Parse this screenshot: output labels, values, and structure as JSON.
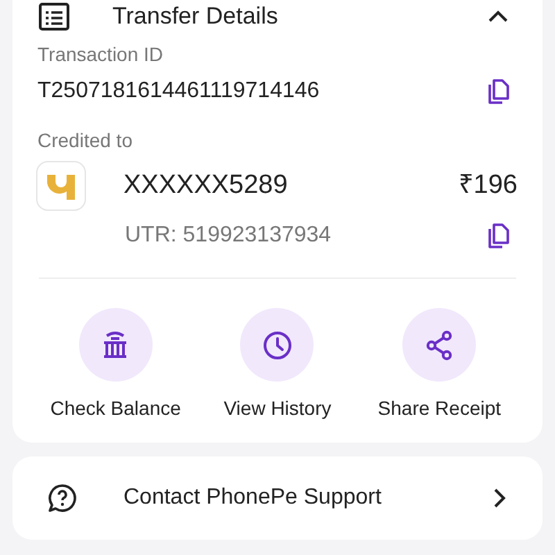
{
  "section": {
    "title": "Transfer Details",
    "expanded": true
  },
  "transaction": {
    "label": "Transaction ID",
    "value": "T2507181614461119714146"
  },
  "credited": {
    "label": "Credited to",
    "account": "XXXXXX5289",
    "amount": "₹196",
    "utr": "UTR: 519923137934"
  },
  "actions": [
    {
      "kind": "bank",
      "label": "Check Balance"
    },
    {
      "kind": "history",
      "label": "View History"
    },
    {
      "kind": "share",
      "label": "Share Receipt"
    }
  ],
  "support": {
    "label": "Contact PhonePe Support"
  }
}
